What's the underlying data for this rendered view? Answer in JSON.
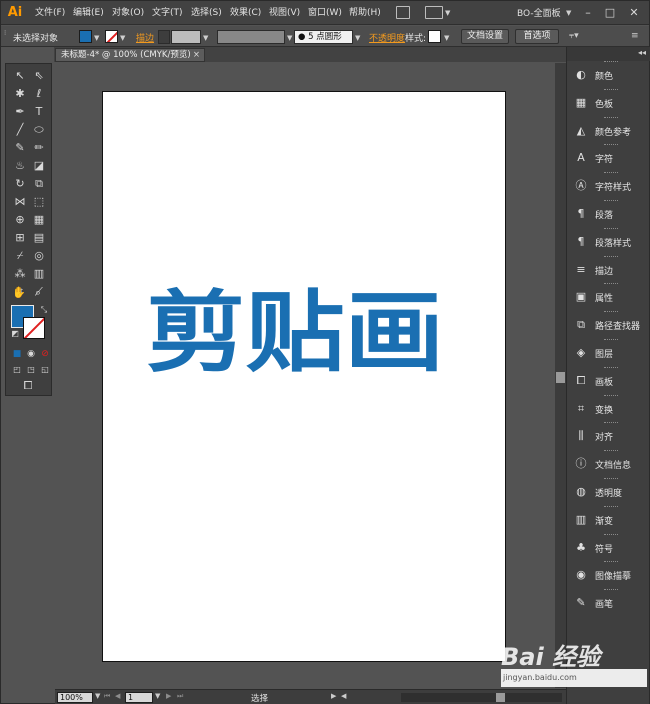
{
  "app": {
    "logo": "Ai",
    "workspace": "BO-全面板"
  },
  "menu": [
    "文件(F)",
    "编辑(E)",
    "对象(O)",
    "文字(T)",
    "选择(S)",
    "效果(C)",
    "视图(V)",
    "窗口(W)",
    "帮助(H)"
  ],
  "window_controls": [
    "–",
    "□",
    "✕"
  ],
  "control_bar": {
    "selection_status": "未选择对象",
    "stroke_label": "描边",
    "brush_value": "5 点圆形",
    "opacity_label": "不透明度",
    "style_label": "样式:",
    "doc_setup_button": "文档设置",
    "preferences_button": "首选项"
  },
  "document": {
    "tab_title": "未标题-4* @ 100% (CMYK/预览)",
    "tab_close": "×",
    "artwork_text": "剪贴画"
  },
  "status_bar": {
    "zoom": "100%",
    "page": "1",
    "status_text": "选择"
  },
  "panels": [
    {
      "label": "颜色",
      "icon": "color-icon"
    },
    {
      "label": "色板",
      "icon": "swatches-icon"
    },
    {
      "label": "颜色参考",
      "icon": "color-guide-icon"
    },
    {
      "label": "字符",
      "icon": "character-icon"
    },
    {
      "label": "字符样式",
      "icon": "character-style-icon"
    },
    {
      "label": "段落",
      "icon": "paragraph-icon"
    },
    {
      "label": "段落样式",
      "icon": "paragraph-style-icon"
    },
    {
      "label": "描边",
      "icon": "stroke-icon"
    },
    {
      "label": "属性",
      "icon": "attributes-icon"
    },
    {
      "label": "路径查找器",
      "icon": "pathfinder-icon"
    },
    {
      "label": "图层",
      "icon": "layers-icon"
    },
    {
      "label": "画板",
      "icon": "artboards-icon"
    },
    {
      "label": "变换",
      "icon": "transform-icon"
    },
    {
      "label": "对齐",
      "icon": "align-icon"
    },
    {
      "label": "文档信息",
      "icon": "document-info-icon"
    },
    {
      "label": "透明度",
      "icon": "transparency-icon"
    },
    {
      "label": "渐变",
      "icon": "gradient-icon"
    },
    {
      "label": "符号",
      "icon": "symbols-icon"
    },
    {
      "label": "图像描摹",
      "icon": "image-trace-icon"
    },
    {
      "label": "画笔",
      "icon": "brushes-icon"
    }
  ],
  "colors": {
    "fill": "#1a6fb2",
    "artwork": "#1a6fb2",
    "stroke_none": "#e02020",
    "accent_label": "#f39a1e"
  },
  "watermark": {
    "line1": "Bai 经验",
    "line2": "jingyan.baidu.com"
  }
}
